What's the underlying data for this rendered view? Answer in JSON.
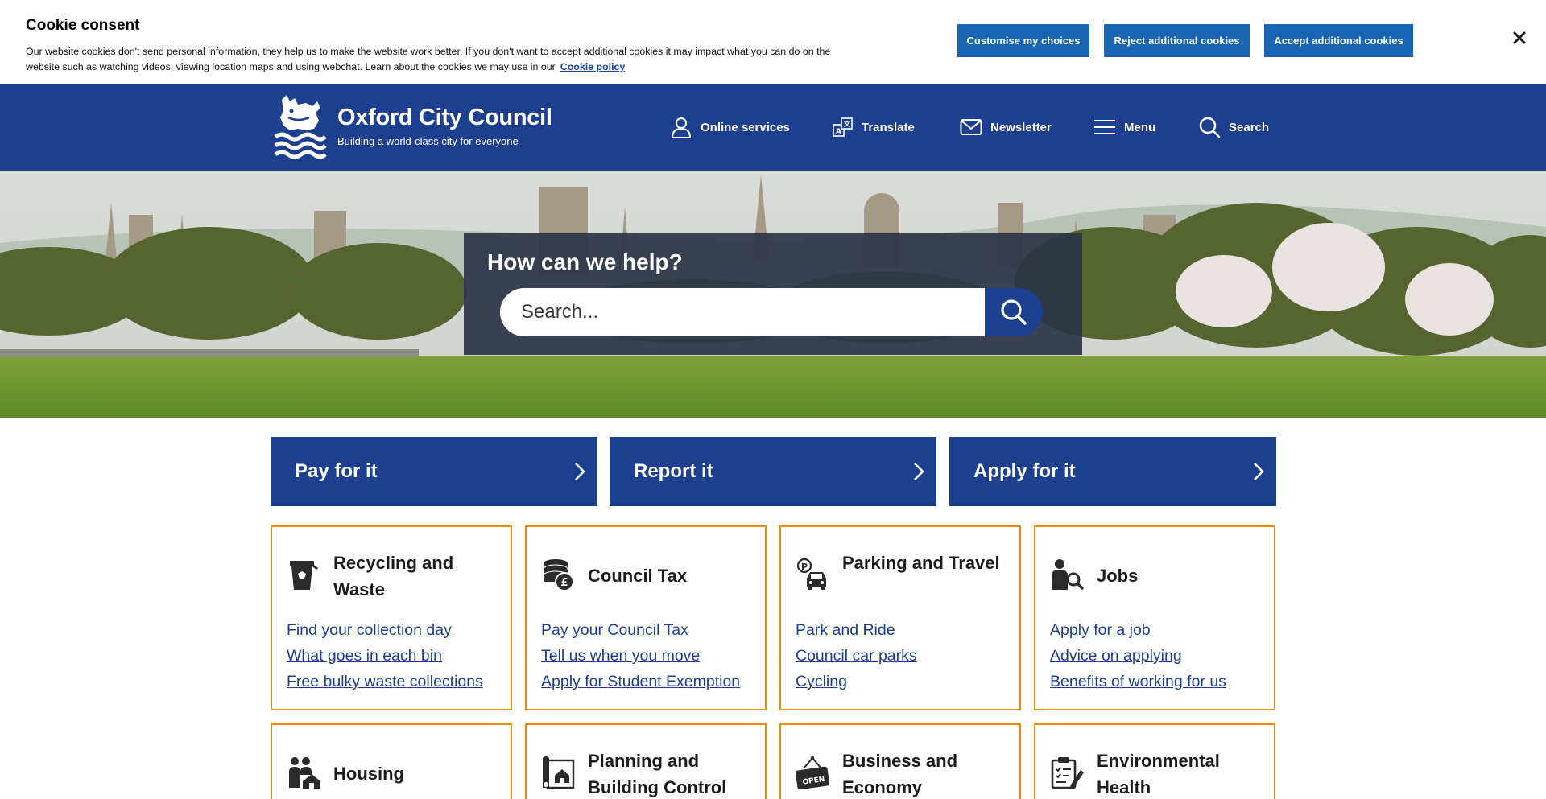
{
  "cookie": {
    "title": "Cookie consent",
    "text": "Our website cookies don't send personal information, they help us to make the website work better. If you don't want to accept additional cookies it may impact what you can do on the website such as watching videos, viewing location maps and using webchat. Learn about the cookies we may use in our",
    "policy_link": "Cookie policy",
    "buttons": {
      "customise": "Customise my choices",
      "reject": "Reject additional cookies",
      "accept": "Accept additional cookies"
    },
    "close_icon": "close-icon"
  },
  "header": {
    "title": "Oxford City Council",
    "tagline": "Building a world-class city for everyone",
    "nav": {
      "online_services": "Online services",
      "translate": "Translate",
      "newsletter": "Newsletter",
      "menu": "Menu",
      "search": "Search"
    }
  },
  "hero": {
    "heading": "How can we help?",
    "search_placeholder": "Search..."
  },
  "actions": [
    {
      "label": "Pay for it"
    },
    {
      "label": "Report it"
    },
    {
      "label": "Apply for it"
    }
  ],
  "categories": [
    {
      "title": "Recycling and Waste",
      "icon": "recycling-bin-icon",
      "links": [
        "Find your collection day",
        "What goes in each bin",
        "Free bulky waste collections"
      ]
    },
    {
      "title": "Council Tax",
      "icon": "coins-icon",
      "links": [
        "Pay your Council Tax",
        "Tell us when you move",
        "Apply for Student Exemption"
      ]
    },
    {
      "title": "Parking and Travel",
      "icon": "parking-car-icon",
      "links": [
        "Park and Ride",
        "Council car parks",
        "Cycling"
      ]
    },
    {
      "title": "Jobs",
      "icon": "person-search-icon",
      "links": [
        "Apply for a job",
        "Advice on applying",
        "Benefits of working for us"
      ]
    },
    {
      "title": "Housing",
      "icon": "family-house-icon",
      "links": []
    },
    {
      "title": "Planning and Building Control",
      "icon": "building-plans-icon",
      "links": []
    },
    {
      "title": "Business and Economy",
      "icon": "open-sign-icon",
      "sign_text": "OPEN",
      "links": []
    },
    {
      "title": "Environmental Health",
      "icon": "clipboard-icon",
      "links": []
    }
  ],
  "colors": {
    "brand_blue": "#1c3f8f",
    "cookie_button_blue": "#1a65b3",
    "card_border_orange": "#f08c00"
  }
}
